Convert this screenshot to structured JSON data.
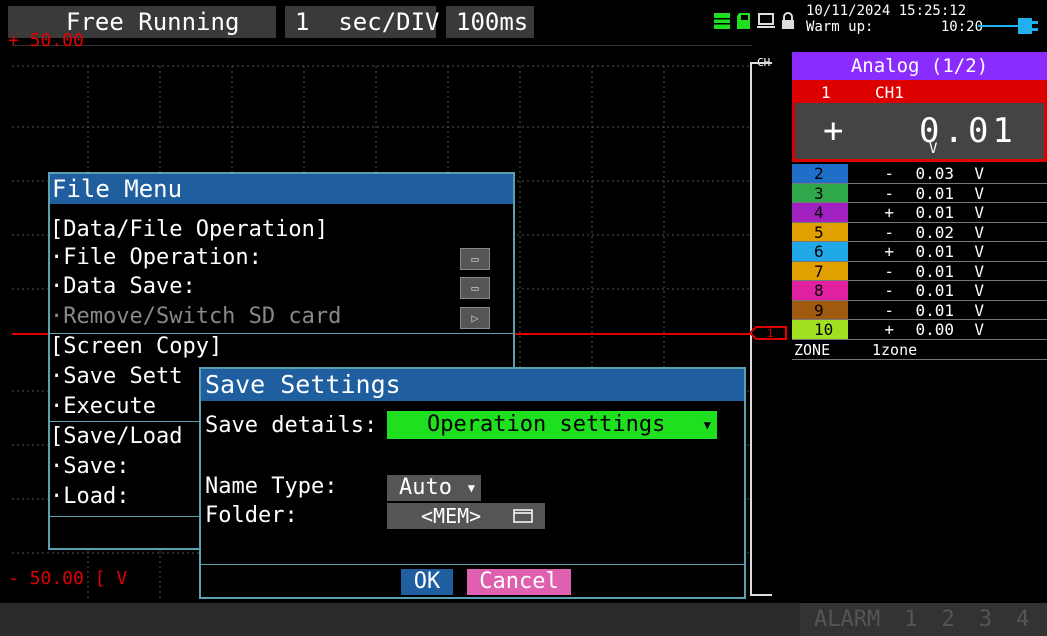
{
  "topbar": {
    "mode": "Free Running",
    "div_num": "1",
    "div_unit": "sec/DIV",
    "rate": "100ms",
    "datetime": "10/11/2024 15:25:12",
    "warmup_label": "Warm up:",
    "warmup_value": "10:20",
    "icons": [
      "memory-icon",
      "sd-card-icon",
      "pc-icon",
      "lock-icon",
      "plug-icon"
    ]
  },
  "graph": {
    "y_top": "+ 50.00",
    "y_bottom": "- 50.00 [ V",
    "ch_label": "CH",
    "marker": "1"
  },
  "panel": {
    "header": "Analog (1/2)",
    "ch1": {
      "num": "1",
      "name": "CH1",
      "sign": "+",
      "value": "0.01",
      "unit": "V"
    },
    "channels": [
      {
        "num": "2",
        "sign": "-",
        "value": "0.03",
        "unit": "V",
        "color": "#1f6fc8"
      },
      {
        "num": "3",
        "sign": "-",
        "value": "0.01",
        "unit": "V",
        "color": "#2ea84a"
      },
      {
        "num": "4",
        "sign": "+",
        "value": "0.01",
        "unit": "V",
        "color": "#a020c0"
      },
      {
        "num": "5",
        "sign": "-",
        "value": "0.02",
        "unit": "V",
        "color": "#e0a000"
      },
      {
        "num": "6",
        "sign": "+",
        "value": "0.01",
        "unit": "V",
        "color": "#20a8e8"
      },
      {
        "num": "7",
        "sign": "-",
        "value": "0.01",
        "unit": "V",
        "color": "#e0a000"
      },
      {
        "num": "8",
        "sign": "-",
        "value": "0.01",
        "unit": "V",
        "color": "#e020a0"
      },
      {
        "num": "9",
        "sign": "-",
        "value": "0.01",
        "unit": "V",
        "color": "#a05a10"
      },
      {
        "num": "10",
        "sign": "+",
        "value": "0.00",
        "unit": "V",
        "color": "#a0e020"
      }
    ],
    "zone_label": "ZONE",
    "zone_value": "1zone"
  },
  "alarm": {
    "label": "ALARM",
    "items": [
      "1",
      "2",
      "3",
      "4"
    ]
  },
  "file_menu": {
    "title": "File Menu",
    "section1": "[Data/File Operation]",
    "file_operation": "·File Operation:",
    "data_save": "·Data Save:",
    "remove_sd": "·Remove/Switch SD card",
    "section2": "[Screen Copy]",
    "save_settings": "·Save Sett",
    "execute": "·Execute",
    "section3": "[Save/Load",
    "save": "·Save:",
    "load": "·Load:"
  },
  "save_settings": {
    "title": "Save Settings",
    "details_label": "Save details:",
    "details_value": "Operation settings",
    "name_type_label": "Name Type:",
    "name_type_value": "Auto",
    "folder_label": "Folder:",
    "folder_value": "<MEM>",
    "ok_label": "OK",
    "cancel_label": "Cancel"
  }
}
